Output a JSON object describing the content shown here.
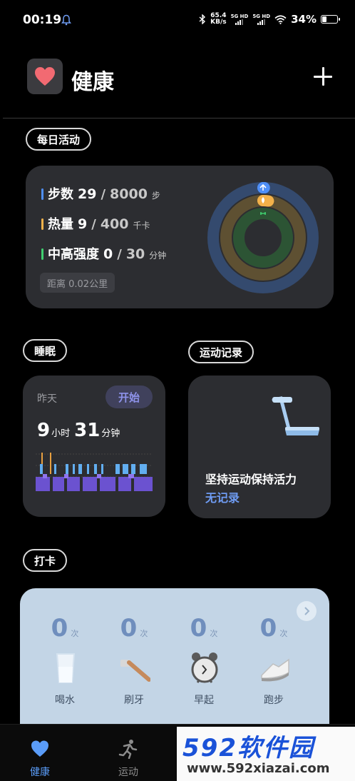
{
  "status_bar": {
    "time": "00:19",
    "net_speed_value": "65.4",
    "net_speed_unit": "KB/s",
    "sim1_label": "5G HD",
    "sim2_label": "5G HD",
    "battery_percent": "34%",
    "battery_level": 0.34,
    "icons": [
      "notification-bell-icon",
      "bluetooth-icon",
      "signal-icon",
      "wifi-icon",
      "battery-icon"
    ]
  },
  "header": {
    "title": "健康",
    "logo_icon": "heart-logo-icon",
    "add_icon": "plus-icon"
  },
  "daily_activity": {
    "section_label": "每日活动",
    "metrics": [
      {
        "label": "步数",
        "value": "29",
        "goal": "8000",
        "unit": "步",
        "color": "#4f8ff7"
      },
      {
        "label": "热量",
        "value": "9",
        "goal": "400",
        "unit": "千卡",
        "color": "#f3b14a"
      },
      {
        "label": "中高强度",
        "value": "0",
        "goal": "30",
        "unit": "分钟",
        "color": "#3fcf6f"
      }
    ],
    "distance": "距离 0.02公里",
    "ring_progress": {
      "steps": 0.004,
      "calories": 0.023,
      "intensity": 0
    }
  },
  "sleep": {
    "section_label": "睡眠",
    "day": "昨天",
    "start_button": "开始",
    "hours": "9",
    "hours_unit": "小时",
    "minutes": "31",
    "minutes_unit": "分钟"
  },
  "exercise": {
    "section_label": "运动记录",
    "title": "坚持运动保持活力",
    "status": "无记录"
  },
  "checkin": {
    "section_label": "打卡",
    "items": [
      {
        "count": "0",
        "unit": "次",
        "name": "喝水",
        "icon": "water-cup-icon"
      },
      {
        "count": "0",
        "unit": "次",
        "name": "刷牙",
        "icon": "toothbrush-icon"
      },
      {
        "count": "0",
        "unit": "次",
        "name": "早起",
        "icon": "alarm-clock-icon"
      },
      {
        "count": "0",
        "unit": "次",
        "name": "跑步",
        "icon": "running-shoe-icon"
      }
    ]
  },
  "tabbar": {
    "tabs": [
      {
        "label": "健康",
        "icon": "heart-tab-icon",
        "active": true
      },
      {
        "label": "运动",
        "icon": "runner-tab-icon",
        "active": false
      }
    ]
  },
  "watermark": {
    "main": "592软件园",
    "url": "www.592xiazai.com"
  },
  "colors": {
    "accent_blue": "#5a9cf8",
    "card_bg": "#2c2d31",
    "checkin_bg": "#c3d5e6"
  }
}
